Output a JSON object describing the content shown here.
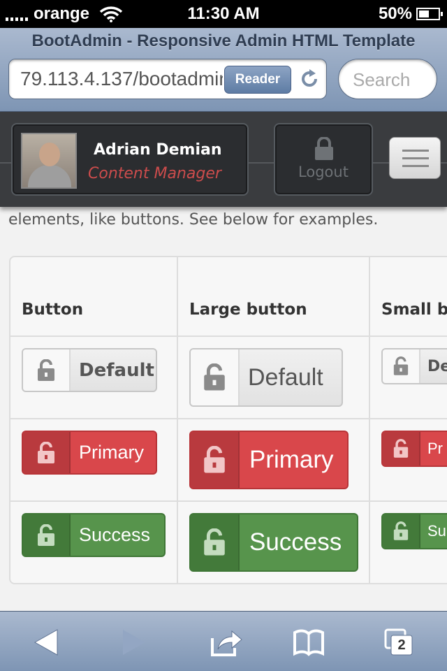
{
  "status_bar": {
    "carrier": "orange",
    "time": "11:30 AM",
    "battery": "50%"
  },
  "browser": {
    "page_title": "BootAdmin - Responsive Admin HTML Template",
    "url": "79.113.4.137/bootadmin",
    "reader_label": "Reader",
    "search_placeholder": "Search",
    "tabs_count": "2"
  },
  "header": {
    "user_name": "Adrian Demian",
    "user_role": "Content Manager",
    "logout_label": "Logout"
  },
  "content": {
    "intro": "elements, like buttons. See below for examples.",
    "columns": [
      "Button",
      "Large button",
      "Small b"
    ],
    "rows": [
      {
        "variant": "default",
        "label": "Default",
        "small_label": "De"
      },
      {
        "variant": "primary",
        "label": "Primary",
        "small_label": "Pr"
      },
      {
        "variant": "success",
        "label": "Success",
        "small_label": "Su"
      }
    ]
  },
  "colors": {
    "primary": "#d9474b",
    "success": "#57944c",
    "default": "#e8e8e8",
    "role_text": "#cc4c4c",
    "toolbar": "#8ea2c0"
  },
  "icons": [
    "wifi-icon",
    "lock-icon",
    "reload-icon",
    "back-icon",
    "forward-icon",
    "share-icon",
    "bookmarks-icon",
    "tabs-icon",
    "menu-icon"
  ]
}
